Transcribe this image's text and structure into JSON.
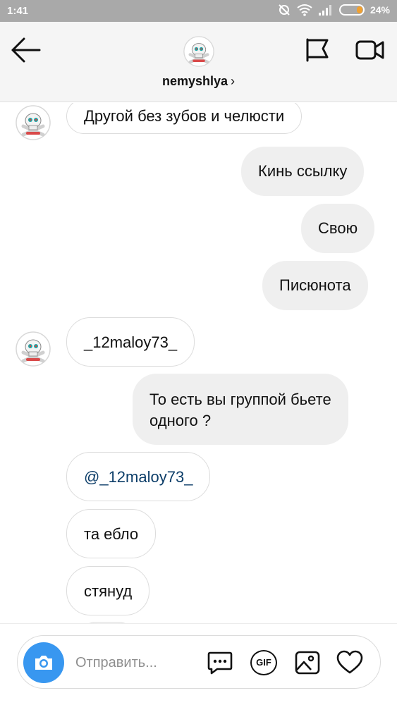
{
  "status_bar": {
    "time": "1:41",
    "battery": "24%",
    "battery_level": 0.24
  },
  "header": {
    "username": "nemyshlya",
    "chevron": "›",
    "icons": {
      "back": "back-arrow-icon",
      "avatar": "skull-avatar",
      "flag": "flag-icon",
      "video": "video-call-icon"
    }
  },
  "messages": [
    {
      "direction": "in",
      "avatar": true,
      "text": "Другой без зубов и челюсти"
    },
    {
      "direction": "out",
      "text": "Кинь ссылку"
    },
    {
      "direction": "out",
      "text": "Свою"
    },
    {
      "direction": "out",
      "text": "Писюнота"
    },
    {
      "direction": "in",
      "avatar": true,
      "text": "_12maloy73_"
    },
    {
      "direction": "out",
      "lines": [
        "То есть вы группой бьете",
        "одного ?"
      ]
    },
    {
      "direction": "in",
      "text": "@_12maloy73_",
      "mention": true
    },
    {
      "direction": "in",
      "text": "та ебло"
    },
    {
      "direction": "in",
      "text": "стянуд"
    }
  ],
  "composer": {
    "placeholder": "Отправить...",
    "gif_label": "GIF",
    "icons": [
      "camera-icon",
      "sticker-chat-icon",
      "gif-icon",
      "gallery-icon",
      "heart-icon"
    ]
  },
  "colors": {
    "accent": "#3897f0",
    "mention": "#0d3e69",
    "outgoing_bubble": "#efefef",
    "status_bar": "#a9a9a9"
  }
}
